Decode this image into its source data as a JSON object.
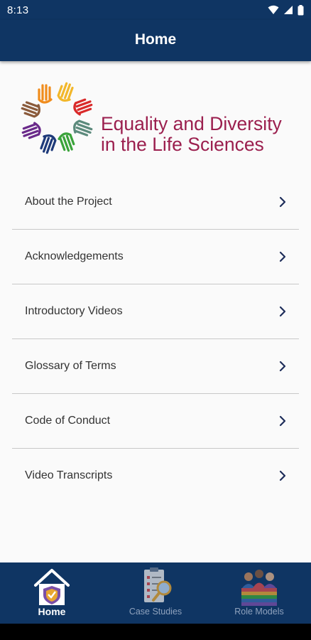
{
  "status_bar": {
    "time": "8:13"
  },
  "app_bar": {
    "title": "Home"
  },
  "logo": {
    "line1": "Equality and Diversity",
    "line2": "in the Life Sciences"
  },
  "menu": {
    "items": [
      {
        "label": "About the Project"
      },
      {
        "label": "Acknowledgements"
      },
      {
        "label": "Introductory Videos"
      },
      {
        "label": "Glossary of Terms"
      },
      {
        "label": "Code of Conduct"
      },
      {
        "label": "Video Transcripts"
      }
    ]
  },
  "bottom_nav": {
    "tabs": [
      {
        "label": "Home",
        "icon": "home-shield-icon",
        "active": true
      },
      {
        "label": "Case Studies",
        "icon": "clipboard-magnifier-icon",
        "active": false
      },
      {
        "label": "Role Models",
        "icon": "people-group-icon",
        "active": false
      }
    ]
  },
  "colors": {
    "primary": "#0f3563",
    "logo_text": "#9b1f4e",
    "chevron": "#1e2d5a",
    "inactive_nav": "#8fa2bd"
  }
}
